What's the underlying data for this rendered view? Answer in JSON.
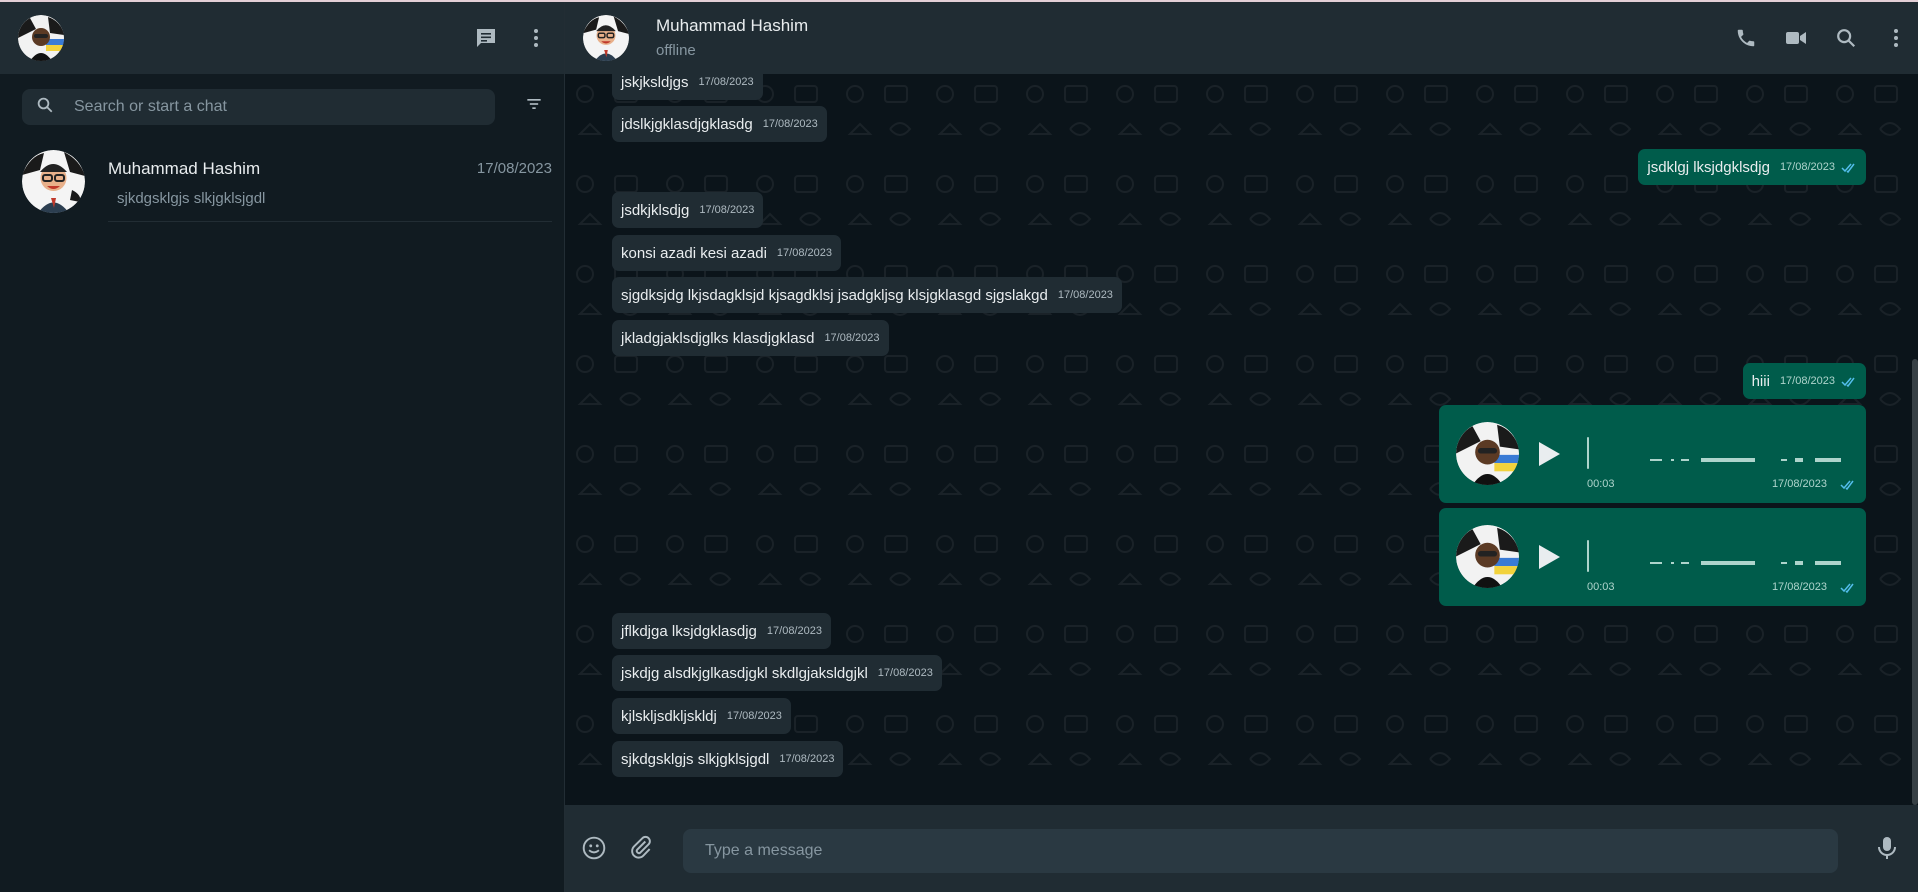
{
  "sidebar": {
    "search_placeholder": "Search or start a chat",
    "chats": [
      {
        "name": "Muhammad Hashim",
        "time": "17/08/2023",
        "preview": "sjkdgsklgjs slkjgklsjgdl"
      }
    ]
  },
  "conversation": {
    "title": "Muhammad Hashim",
    "status": "offline",
    "messages": [
      {
        "direction": "in",
        "text": "jskjksldjgs",
        "time": "17/08/2023"
      },
      {
        "direction": "in",
        "text": "jdslkjgklasdjgklasdg",
        "time": "17/08/2023"
      },
      {
        "direction": "out",
        "text": "jsdklgj lksjdgklsdjg",
        "time": "17/08/2023"
      },
      {
        "direction": "in",
        "text": "jsdkjklsdjg",
        "time": "17/08/2023"
      },
      {
        "direction": "in",
        "text": "konsi azadi kesi azadi",
        "time": "17/08/2023"
      },
      {
        "direction": "in",
        "text": "sjgdksjdg lkjsdagklsjd kjsagdklsj jsadgkljsg klsjgklasgd sjgslakgd",
        "time": "17/08/2023"
      },
      {
        "direction": "in",
        "text": "jkladgjaklsdjglks klasdjgklasd",
        "time": "17/08/2023"
      },
      {
        "direction": "out",
        "text": "hiii",
        "time": "17/08/2023"
      },
      {
        "direction": "in",
        "text": "jflkdjga lksjdgklasdjg",
        "time": "17/08/2023"
      },
      {
        "direction": "in",
        "text": "jskdjg alsdkjglkasdjgkl skdlgjaksldgjkl",
        "time": "17/08/2023"
      },
      {
        "direction": "in",
        "text": "kjlskljsdkljskldj",
        "time": "17/08/2023"
      },
      {
        "direction": "in",
        "text": "sjkdgsklgjs slkjgklsjgdl",
        "time": "17/08/2023"
      }
    ],
    "voice_notes": [
      {
        "duration": "00:03",
        "time": "17/08/2023"
      },
      {
        "duration": "00:03",
        "time": "17/08/2023"
      }
    ]
  },
  "composer": {
    "placeholder": "Type a message"
  },
  "colors": {
    "panel": "#202c33",
    "background": "#111b21",
    "chat_bg": "#0b141a",
    "incoming": "#202c33",
    "outgoing": "#005c4b",
    "read_ticks": "#53bdeb",
    "icon": "#aebac1"
  }
}
